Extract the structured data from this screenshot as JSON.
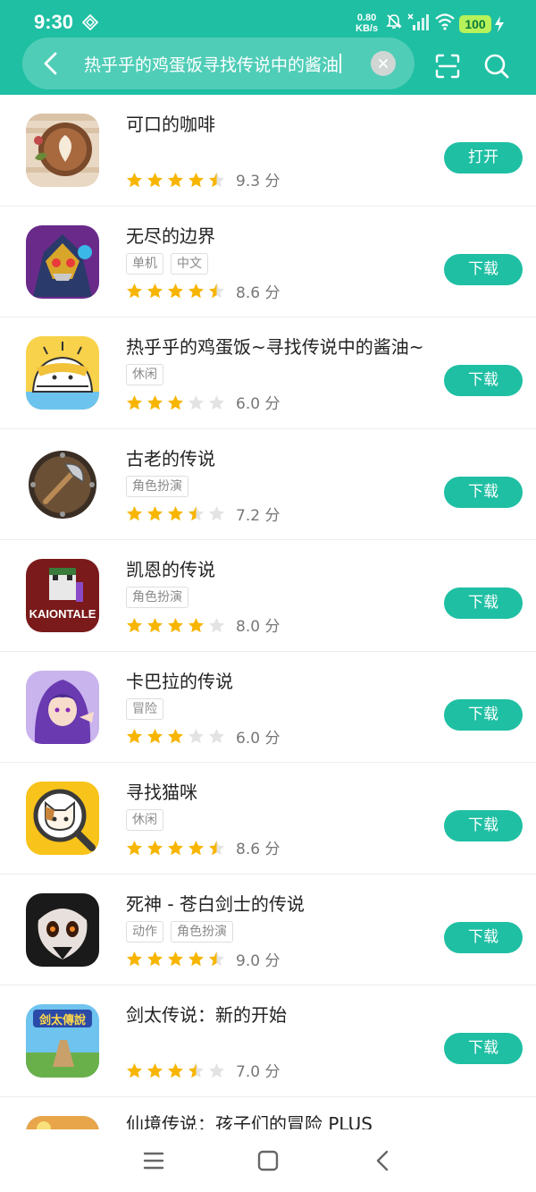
{
  "status_bar": {
    "time": "9:30",
    "speed_value": "0.80",
    "speed_unit": "KB/s",
    "battery": "100"
  },
  "search": {
    "query": "热乎乎的鸡蛋饭寻找传说中的酱油"
  },
  "colors": {
    "accent": "#1fbfa3",
    "star_on": "#f7b500",
    "star_off": "#e3e3e3"
  },
  "items": [
    {
      "name": "可口的咖啡",
      "tags": [],
      "rating": 4.5,
      "score": "9.3 分",
      "action": "打开",
      "icon": "coffee-latte-icon"
    },
    {
      "name": "无尽的边界",
      "tags": [
        "单机",
        "中文"
      ],
      "rating": 4.5,
      "score": "8.6 分",
      "action": "下载",
      "icon": "armored-monster-icon"
    },
    {
      "name": "热乎乎的鸡蛋饭~寻找传说中的酱油~",
      "tags": [
        "休闲"
      ],
      "rating": 3,
      "score": "6.0 分",
      "action": "下载",
      "icon": "egg-rice-icon"
    },
    {
      "name": "古老的传说",
      "tags": [
        "角色扮演"
      ],
      "rating": 3.5,
      "score": "7.2 分",
      "action": "下载",
      "icon": "axe-shield-icon"
    },
    {
      "name": "凯恩的传说",
      "tags": [
        "角色扮演"
      ],
      "rating": 4,
      "score": "8.0 分",
      "action": "下载",
      "icon": "kaiontale-icon",
      "icon_text": "KAIONTALE"
    },
    {
      "name": "卡巴拉的传说",
      "tags": [
        "冒险"
      ],
      "rating": 3,
      "score": "6.0 分",
      "action": "下载",
      "icon": "anime-girl-icon"
    },
    {
      "name": "寻找猫咪",
      "tags": [
        "休闲"
      ],
      "rating": 4.5,
      "score": "8.6 分",
      "action": "下载",
      "icon": "cat-magnifier-icon"
    },
    {
      "name": "死神 - 苍白剑士的传说",
      "tags": [
        "动作",
        "角色扮演"
      ],
      "rating": 4.5,
      "score": "9.0 分",
      "action": "下载",
      "icon": "dark-mask-icon"
    },
    {
      "name": "剑太传说：新的开始",
      "tags": [],
      "rating": 3.5,
      "score": "7.0 分",
      "action": "下载",
      "icon": "sword-legend-icon",
      "icon_text": "剑太傳說"
    },
    {
      "name": "仙境传说：孩子们的冒险 PLUS",
      "tags": [],
      "rating": 0,
      "score": "",
      "action": "",
      "icon": "wonderland-icon"
    }
  ]
}
